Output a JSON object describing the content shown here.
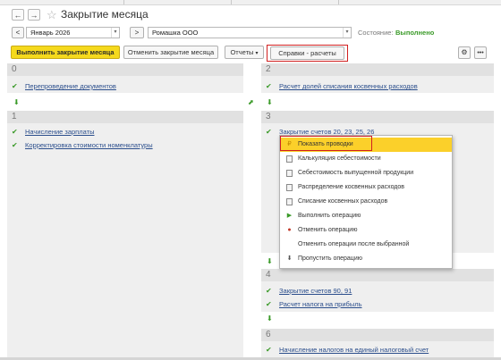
{
  "window": {
    "title": "Закрытие месяца"
  },
  "toolbar": {
    "back_icon": "arrow-left-icon",
    "forward_icon": "arrow-right-icon",
    "prev_label": "<",
    "next_label": ">",
    "period_value": "Январь 2026",
    "org_value": "Ромашка ООО",
    "status_label": "Состояние:",
    "status_value": "Выполнено"
  },
  "actions": {
    "run_label": "Выполнить закрытие месяца",
    "cancel_label": "Отменить закрытие месяца",
    "reports_label": "Отчеты",
    "refs_label": "Справки - расчеты"
  },
  "blocks": {
    "b0": {
      "num": "0",
      "items": [
        "Перепроведение документов"
      ]
    },
    "b1": {
      "num": "1",
      "items": [
        "Начисление зарплаты",
        "Корректировка стоимости номенклатуры"
      ]
    },
    "b2": {
      "num": "2",
      "items": [
        "Расчет долей списания косвенных расходов"
      ]
    },
    "b3": {
      "num": "3",
      "items": [
        "Закрытие счетов 20, 23, 25, 26"
      ]
    },
    "b4": {
      "num": "4",
      "items": [
        "Закрытие счетов 90, 91",
        "Расчет налога на прибыль"
      ]
    },
    "b6": {
      "num": "6",
      "items": [
        "Начисление налогов на единый налоговый счет"
      ]
    }
  },
  "context_menu": {
    "items": [
      "Показать проводки",
      "Калькуляция себестоимости",
      "Себестоимость выпущенной продукции",
      "Распределение косвенных расходов",
      "Списание косвенных расходов",
      "Выполнить операцию",
      "Отменить операцию",
      "Отменить операции после выбранной",
      "Пропустить операцию"
    ]
  },
  "colors": {
    "accent": "#f5d91d",
    "status": "#3a9a28",
    "link": "#2b4e8c",
    "highlight_border": "#d12020"
  }
}
